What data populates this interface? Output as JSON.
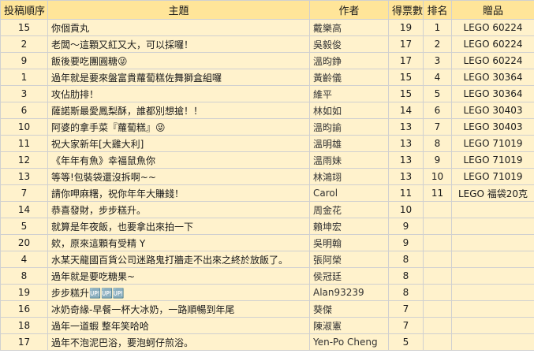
{
  "headers": [
    "投稿順序",
    "主題",
    "作者",
    "得票數",
    "排名",
    "贈品"
  ],
  "rows": [
    {
      "id": "15",
      "title": "你個貢丸",
      "author": "戴樂高",
      "votes": "19",
      "rank": "1",
      "prize": "LEGO 60224"
    },
    {
      "id": "2",
      "title": "老闆～這顆又紅又大，可以採囉！",
      "author": "吳毅俊",
      "votes": "17",
      "rank": "2",
      "prize": "LEGO 60224"
    },
    {
      "id": "9",
      "title": "飯後要吃團圓糖😜",
      "author": "溫昀錚",
      "votes": "17",
      "rank": "3",
      "prize": "LEGO 60224"
    },
    {
      "id": "1",
      "title": "過年就是要來盤富貴蘿蔔糕佐舞獅盒組囉",
      "author": "黃齡儀",
      "votes": "15",
      "rank": "4",
      "prize": "LEGO 30364"
    },
    {
      "id": "3",
      "title": "攻佔肋排！",
      "author": "維平",
      "votes": "15",
      "rank": "5",
      "prize": "LEGO 30364"
    },
    {
      "id": "6",
      "title": "薩諾斯最愛鳳梨酥，誰都別想搶！！",
      "author": "林如如",
      "votes": "14",
      "rank": "6",
      "prize": "LEGO 30403"
    },
    {
      "id": "10",
      "title": "阿婆的拿手菜『蘿蔔糕』😜",
      "author": "溫昀諭",
      "votes": "13",
      "rank": "7",
      "prize": "LEGO 30403"
    },
    {
      "id": "11",
      "title": "祝大家新年[大雞大利]",
      "author": "溫明雄",
      "votes": "13",
      "rank": "8",
      "prize": "LEGO 71019"
    },
    {
      "id": "12",
      "title": "《年年有魚》幸福鼠魚你",
      "author": "溫雨妹",
      "votes": "13",
      "rank": "9",
      "prize": "LEGO 71019"
    },
    {
      "id": "13",
      "title": "等等!包裝袋還沒拆啊~~",
      "author": "林鴻翊",
      "votes": "13",
      "rank": "10",
      "prize": "LEGO 71019"
    },
    {
      "id": "7",
      "title": "請你呷麻糬，祝你年年大賺錢！",
      "author": "Carol",
      "votes": "11",
      "rank": "11",
      "prize": "LEGO 福袋20克"
    },
    {
      "id": "14",
      "title": "恭喜發財，步步糕升。",
      "author": "周金花",
      "votes": "10",
      "rank": "",
      "prize": ""
    },
    {
      "id": "5",
      "title": "就算是年夜飯，也要拿出來拍一下",
      "author": "賴坤宏",
      "votes": "9",
      "rank": "",
      "prize": ""
    },
    {
      "id": "20",
      "title": "欸，原來這顆有受精 Y",
      "author": "吳明翰",
      "votes": "9",
      "rank": "",
      "prize": ""
    },
    {
      "id": "4",
      "title": "水某天龍國百貨公司迷路鬼打牆走不出來之終於放飯了。",
      "author": "張阿榮",
      "votes": "8",
      "rank": "",
      "prize": ""
    },
    {
      "id": "8",
      "title": "過年就是要吃糖果~",
      "author": "侯冠廷",
      "votes": "8",
      "rank": "",
      "prize": ""
    },
    {
      "id": "19",
      "title": "步步糕升🆙🆙🆙",
      "author": "Alan93239",
      "votes": "8",
      "rank": "",
      "prize": ""
    },
    {
      "id": "16",
      "title": "冰奶奇緣-早餐一杯大冰奶，一路順暢到年尾",
      "author": "葵傑",
      "votes": "7",
      "rank": "",
      "prize": ""
    },
    {
      "id": "18",
      "title": "過年一道蝦 整年笑哈哈",
      "author": "陳淑憲",
      "votes": "7",
      "rank": "",
      "prize": ""
    },
    {
      "id": "17",
      "title": "過年不泡泥巴浴，要泡蚵仔煎浴。",
      "author": "Yen-Po Cheng",
      "votes": "5",
      "rank": "",
      "prize": ""
    }
  ]
}
